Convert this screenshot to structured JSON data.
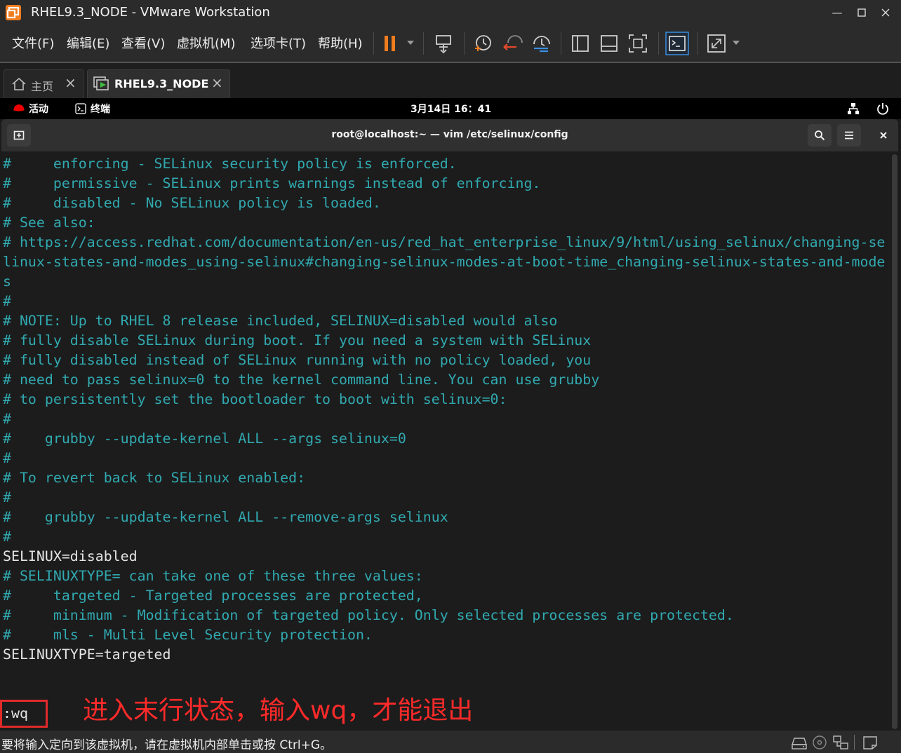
{
  "window": {
    "title": "RHEL9.3_NODE - VMware Workstation",
    "controls": [
      "minimize-icon",
      "maximize-icon",
      "close-icon"
    ]
  },
  "menubar": {
    "items": [
      "文件(F)",
      "编辑(E)",
      "查看(V)",
      "虚拟机(M)",
      "选项卡(T)",
      "帮助(H)"
    ],
    "toolbar_icons": [
      "pause-icon",
      "send-ctrl-alt-del-icon",
      "snapshot-icon",
      "revert-snapshot-icon",
      "snapshot-manager-icon",
      "library-view-icon",
      "thumbnail-view-icon",
      "fullscreen-icon",
      "console-view-icon",
      "stretch-icon"
    ],
    "accent_color": "#f07c1e"
  },
  "tabs": [
    {
      "label": "主页",
      "active": false
    },
    {
      "label": "RHEL9.3_NODE",
      "active": true
    }
  ],
  "gnome_bar": {
    "activities": "活动",
    "terminal_app": "终端",
    "datetime": "3月14日 16：41"
  },
  "terminal": {
    "title": "root@localhost:~ — vim /etc/selinux/config",
    "lines": [
      {
        "text": "#     enforcing - SELinux security policy is enforced.",
        "kind": "comment"
      },
      {
        "text": "#     permissive - SELinux prints warnings instead of enforcing.",
        "kind": "comment"
      },
      {
        "text": "#     disabled - No SELinux policy is loaded.",
        "kind": "comment"
      },
      {
        "text": "# See also:",
        "kind": "comment"
      },
      {
        "text": "# https://access.redhat.com/documentation/en-us/red_hat_enterprise_linux/9/html/using_selinux/changing-se",
        "kind": "comment"
      },
      {
        "text": "linux-states-and-modes_using-selinux#changing-selinux-modes-at-boot-time_changing-selinux-states-and-mode",
        "kind": "comment"
      },
      {
        "text": "s",
        "kind": "comment"
      },
      {
        "text": "#",
        "kind": "comment"
      },
      {
        "text": "# NOTE: Up to RHEL 8 release included, SELINUX=disabled would also",
        "kind": "comment"
      },
      {
        "text": "# fully disable SELinux during boot. If you need a system with SELinux",
        "kind": "comment"
      },
      {
        "text": "# fully disabled instead of SELinux running with no policy loaded, you",
        "kind": "comment"
      },
      {
        "text": "# need to pass selinux=0 to the kernel command line. You can use grubby",
        "kind": "comment"
      },
      {
        "text": "# to persistently set the bootloader to boot with selinux=0:",
        "kind": "comment"
      },
      {
        "text": "#",
        "kind": "comment"
      },
      {
        "text": "#    grubby --update-kernel ALL --args selinux=0",
        "kind": "comment"
      },
      {
        "text": "#",
        "kind": "comment"
      },
      {
        "text": "# To revert back to SELinux enabled:",
        "kind": "comment"
      },
      {
        "text": "#",
        "kind": "comment"
      },
      {
        "text": "#    grubby --update-kernel ALL --remove-args selinux",
        "kind": "comment"
      },
      {
        "text": "#",
        "kind": "comment"
      },
      {
        "text": "SELINUX=disabled",
        "kind": "plain"
      },
      {
        "text": "# SELINUXTYPE= can take one of these three values:",
        "kind": "comment"
      },
      {
        "text": "#     targeted - Targeted processes are protected,",
        "kind": "comment"
      },
      {
        "text": "#     minimum - Modification of targeted policy. Only selected processes are protected.",
        "kind": "comment"
      },
      {
        "text": "#     mls - Multi Level Security protection.",
        "kind": "comment"
      },
      {
        "text": "SELINUXTYPE=targeted",
        "kind": "plain"
      }
    ],
    "command_line": ":wq",
    "comment_color": "#31a9b0",
    "text_color": "#e4e4e4"
  },
  "annotation": {
    "text": "进入末行状态，输入wq，才能退出",
    "color": "#ff2a2a"
  },
  "statusbar": {
    "text": "要将输入定向到该虚拟机，请在虚拟机内部单击或按 Ctrl+G。",
    "icons": [
      "hard-disk-icon",
      "cd-drive-icon",
      "network-icon",
      "message-icon"
    ]
  }
}
